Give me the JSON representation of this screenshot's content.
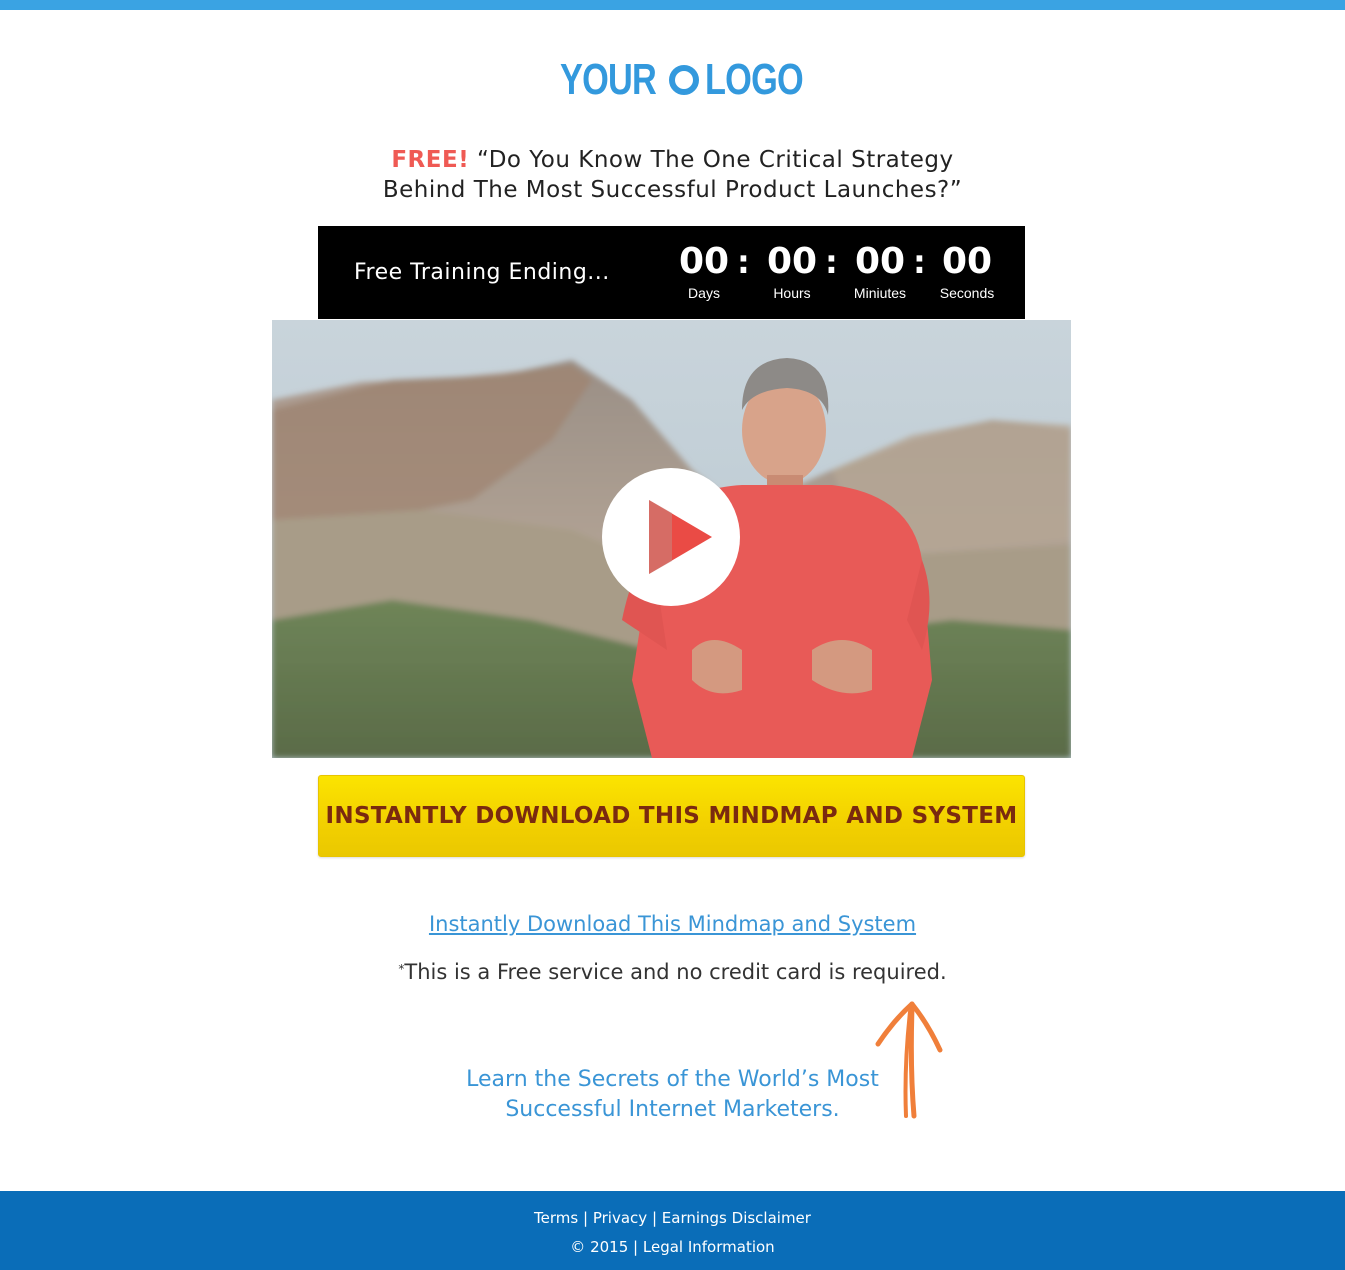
{
  "brand": {
    "logo_part1": "YOUR",
    "logo_part2": "LOGO",
    "accent_color": "#3399dd",
    "top_bar_color": "#3aa3e3"
  },
  "headline": {
    "free_tag": "FREE!",
    "line1": "“Do You Know The One Critical Strategy",
    "line2": "Behind The Most Successful Product Launches?”"
  },
  "countdown": {
    "label": "Free Training Ending...",
    "days": "00",
    "days_label": "Days",
    "hours": "00",
    "hours_label": "Hours",
    "minutes": "00",
    "minutes_label": "Miniutes",
    "seconds": "00",
    "seconds_label": "Seconds",
    "separator": ":"
  },
  "video": {
    "play_icon": "play-icon"
  },
  "cta": {
    "button_label": "INSTANTLY DOWNLOAD THIS MINDMAP AND SYSTEM",
    "button_color": "#f6dc00",
    "text_color": "#7a2a0f"
  },
  "download_link": "Instantly Download This Mindmap and System",
  "disclaimer": {
    "asterisk": "*",
    "text": "This is a Free service and no credit card is required."
  },
  "secrets": {
    "line1": "Learn the Secrets of the World’s Most",
    "line2": "Successful Internet Marketers."
  },
  "footer": {
    "terms": "Terms",
    "privacy": "Privacy",
    "earnings": "Earnings Disclaimer",
    "copyright": "© 2015",
    "legal": "Legal Information",
    "divider": "|",
    "background": "#0a6db8"
  }
}
